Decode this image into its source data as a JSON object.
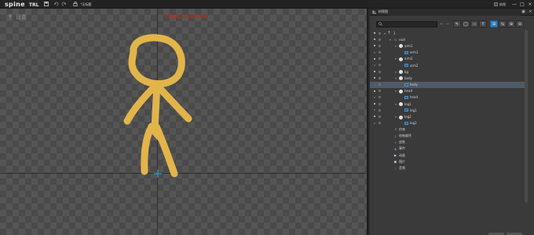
{
  "topbar": {
    "logo_text": "spine",
    "edition_label": "TRL",
    "project_name": "*无标题",
    "view_badge": "前视",
    "window_controls": [
      "—",
      "□",
      "×"
    ]
  },
  "viewport": {
    "mode_label": "设置",
    "trial_text": "TRIAL VERSION"
  },
  "tree_panel": {
    "title": "树视图",
    "header_controls": [
      "▣",
      "×"
    ],
    "search_placeholder": "",
    "nav": [
      "←",
      "→"
    ],
    "tools": [
      {
        "label": "✎",
        "active": false
      },
      {
        "label": "◯",
        "active": false
      },
      {
        "label": "▭",
        "active": false
      },
      {
        "label": "Y",
        "active": false
      },
      {
        "label": "⊞",
        "active": true
      },
      {
        "label": "⇆",
        "active": false
      },
      {
        "label": "⊕",
        "active": false
      },
      {
        "label": "⊖",
        "active": false
      }
    ],
    "rows": [
      {
        "depth": 0,
        "caret": "▾",
        "type": "skeleton",
        "label": "1",
        "eye": "on",
        "sel": false
      },
      {
        "depth": 1,
        "caret": "▾",
        "type": "root",
        "label": "root",
        "eye": "on",
        "sel": false
      },
      {
        "depth": 2,
        "caret": "▾",
        "type": "bone",
        "label": "arm1",
        "eye": "on",
        "sel": false
      },
      {
        "depth": 3,
        "caret": "",
        "type": "slot",
        "label": "arm1",
        "eye": "dim",
        "sel": false
      },
      {
        "depth": 2,
        "caret": "▾",
        "type": "bone",
        "label": "arm2",
        "eye": "on",
        "sel": false
      },
      {
        "depth": 3,
        "caret": "",
        "type": "slot",
        "label": "arm2",
        "eye": "dim",
        "sel": false
      },
      {
        "depth": 2,
        "caret": "▾",
        "type": "bone",
        "label": "bg",
        "eye": "on",
        "sel": false
      },
      {
        "depth": 2,
        "caret": "▾",
        "type": "bone",
        "label": "body",
        "eye": "on",
        "sel": false
      },
      {
        "depth": 3,
        "caret": "",
        "type": "slot",
        "label": "body",
        "eye": "dim",
        "sel": true
      },
      {
        "depth": 2,
        "caret": "▾",
        "type": "bone",
        "label": "head",
        "eye": "on",
        "sel": false
      },
      {
        "depth": 3,
        "caret": "",
        "type": "slot",
        "label": "head",
        "eye": "dim",
        "sel": false
      },
      {
        "depth": 2,
        "caret": "▾",
        "type": "bone",
        "label": "leg1",
        "eye": "on",
        "sel": false
      },
      {
        "depth": 3,
        "caret": "",
        "type": "slot",
        "label": "leg1",
        "eye": "dim",
        "sel": false
      },
      {
        "depth": 2,
        "caret": "▾",
        "type": "bone",
        "label": "leg2",
        "eye": "on",
        "sel": false
      },
      {
        "depth": 3,
        "caret": "",
        "type": "slot",
        "label": "leg2",
        "eye": "dim",
        "sel": false
      },
      {
        "depth": 1,
        "caret": "",
        "type": "node",
        "label": "约束",
        "eye": "none",
        "sel": false,
        "icon_color": "#bbbbbb",
        "icon": "↗"
      },
      {
        "depth": 1,
        "caret": "",
        "type": "node",
        "label": "绘制顺序",
        "eye": "none",
        "sel": false,
        "icon_color": "#e07a2f",
        "icon": "↕"
      },
      {
        "depth": 1,
        "caret": "",
        "type": "node",
        "label": "皮肤",
        "eye": "none",
        "sel": false,
        "icon_color": "#d94c4c",
        "icon": "✦"
      },
      {
        "depth": 1,
        "caret": "",
        "type": "node",
        "label": "事件",
        "eye": "none",
        "sel": false,
        "icon_color": "#7a6fd0",
        "icon": "◆"
      },
      {
        "depth": 1,
        "caret": "",
        "type": "node",
        "label": "动画",
        "eye": "none",
        "sel": false,
        "icon_color": "#cfcfcf",
        "icon": "▶"
      },
      {
        "depth": 1,
        "caret": "",
        "type": "node",
        "label": "图片",
        "eye": "none",
        "sel": false,
        "icon_color": "#cfcfcf",
        "icon": "▣"
      },
      {
        "depth": 1,
        "caret": "",
        "type": "node",
        "label": "音频",
        "eye": "none",
        "sel": false,
        "icon_color": "#59b56a",
        "icon": "♪"
      }
    ]
  },
  "colors": {
    "figure": "#e2b54a",
    "selection": "#4e5b66",
    "tool_active": "#2f7fc1",
    "trial_red": "#c0281f"
  }
}
